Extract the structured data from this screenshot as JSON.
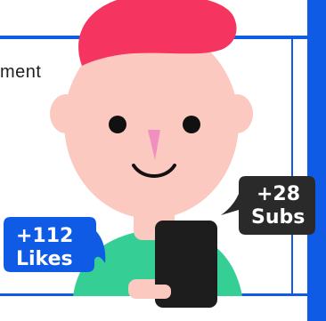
{
  "snippet_text": "ment",
  "badges": {
    "likes": {
      "count": "+112",
      "label": "Likes"
    },
    "subs": {
      "count": "+28",
      "label": "Subs"
    }
  },
  "colors": {
    "accent_blue": "#0f5be6",
    "hair": "#f5345f",
    "skin": "#fcc9c0",
    "nose": "#f08fc0",
    "shirt": "#35cf95",
    "phone": "#1d1d1d",
    "subs_bubble": "#2a2a2a"
  }
}
